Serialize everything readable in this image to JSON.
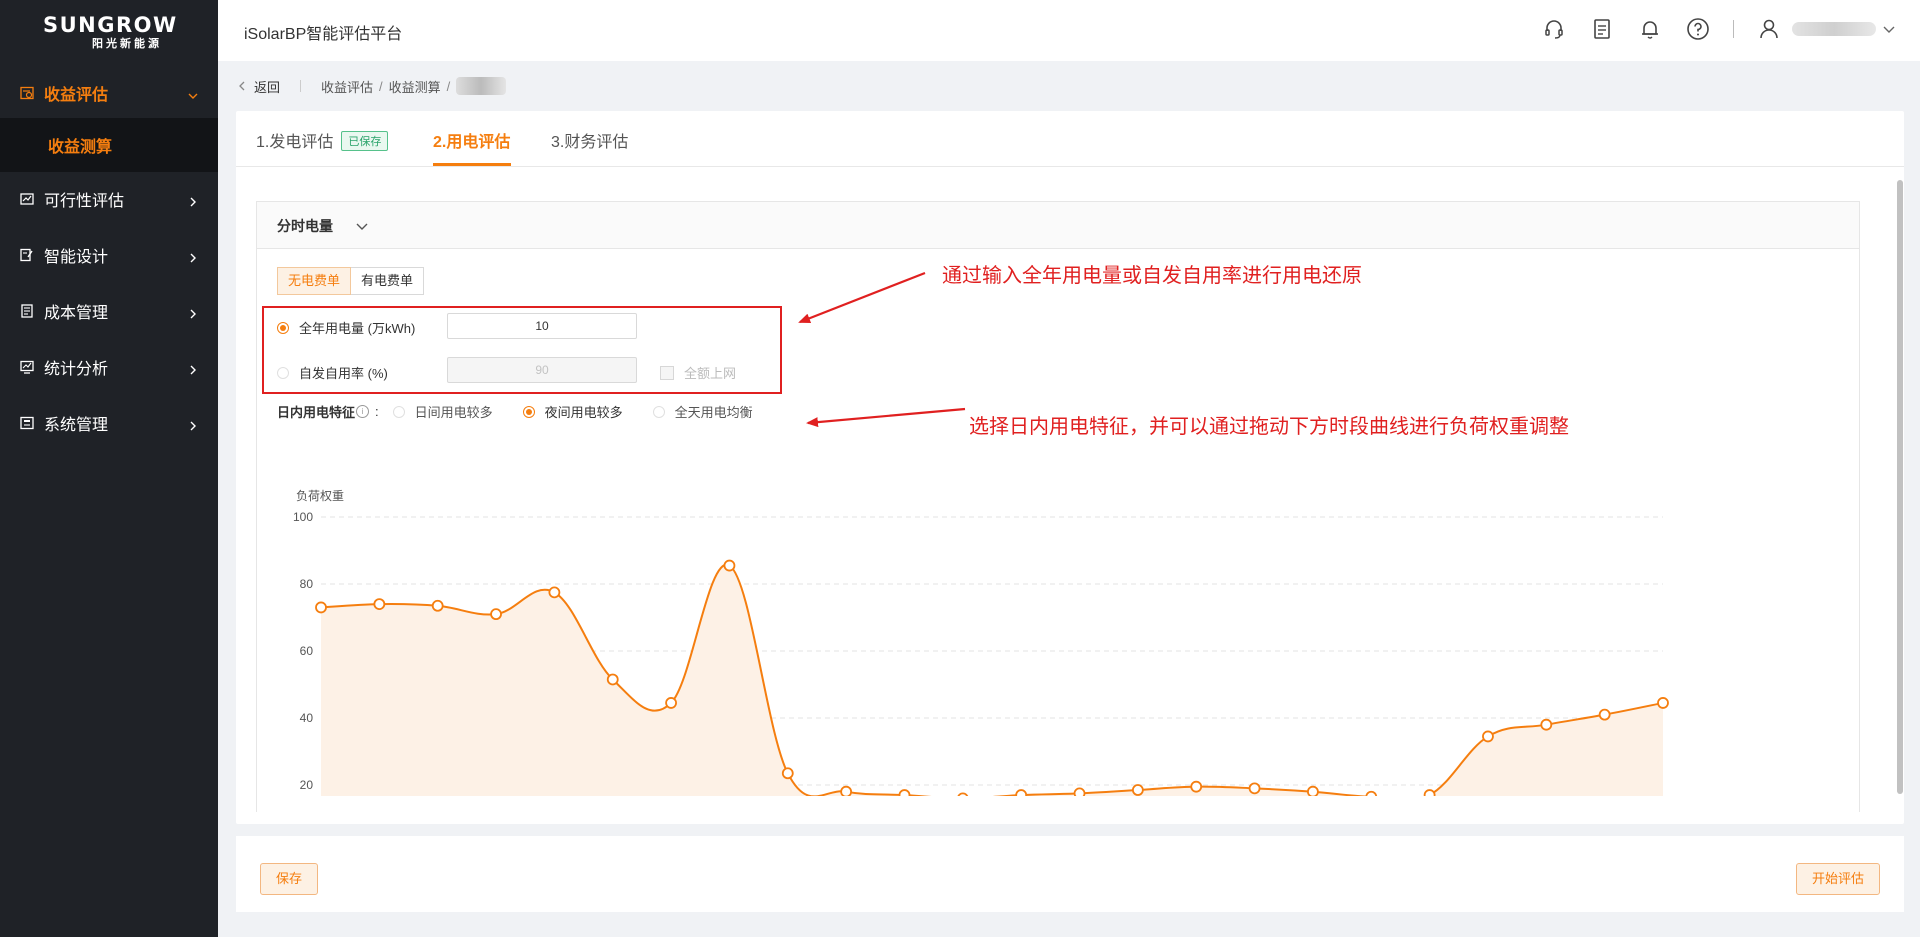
{
  "brand": {
    "name": "SUNGROW",
    "subtitle": "阳光新能源"
  },
  "app_title": "iSolarBP智能评估平台",
  "sidebar": {
    "items": [
      {
        "label": "收益评估",
        "icon": "revenue-icon",
        "expanded": true
      },
      {
        "label": "可行性评估",
        "icon": "feasibility-icon"
      },
      {
        "label": "智能设计",
        "icon": "design-icon"
      },
      {
        "label": "成本管理",
        "icon": "cost-icon"
      },
      {
        "label": "统计分析",
        "icon": "stats-icon"
      },
      {
        "label": "系统管理",
        "icon": "system-icon"
      }
    ],
    "submenu": {
      "label": "收益测算"
    }
  },
  "breadcrumb": {
    "back": "返回",
    "level1": "收益评估",
    "level2": "收益测算"
  },
  "tabs": [
    {
      "label": "1.发电评估",
      "badge": "已保存"
    },
    {
      "label": "2.用电评估",
      "active": true
    },
    {
      "label": "3.财务评估"
    }
  ],
  "panel": {
    "title": "分时电量"
  },
  "bill_options": [
    "无电费单",
    "有电费单"
  ],
  "form": {
    "annual_label": "全年用电量 (万kWh)",
    "annual_value": "10",
    "self_use_label": "自发自用率 (%)",
    "self_use_value": "90",
    "full_grid_label": "全额上网"
  },
  "daily": {
    "title": "日内用电特征",
    "options": [
      "日间用电较多",
      "夜间用电较多",
      "全天用电均衡"
    ],
    "selected": "夜间用电较多"
  },
  "annotations": {
    "top": "通过输入全年用电量或自发自用率进行用电还原",
    "bottom": "选择日内用电特征，并可以通过拖动下方时段曲线进行负荷权重调整"
  },
  "colors": {
    "accent": "#f57e0f",
    "annotation": "#e02020",
    "sidebar_bg": "#1f2227"
  },
  "chart_data": {
    "type": "area",
    "ylabel": "负荷权重",
    "y_ticks": [
      100,
      80,
      60,
      40,
      20
    ],
    "ylim": [
      0,
      100
    ],
    "grid": true,
    "series": [
      {
        "values": [
          73,
          74,
          73.5,
          71,
          77.5,
          51.5,
          44.5,
          85.5,
          23.5,
          18,
          17,
          16,
          17,
          17.5,
          18.5,
          19.5,
          19,
          18,
          16.5,
          17,
          34.5,
          38,
          41,
          44.5
        ]
      }
    ]
  },
  "footer": {
    "save": "保存",
    "start": "开始评估"
  }
}
